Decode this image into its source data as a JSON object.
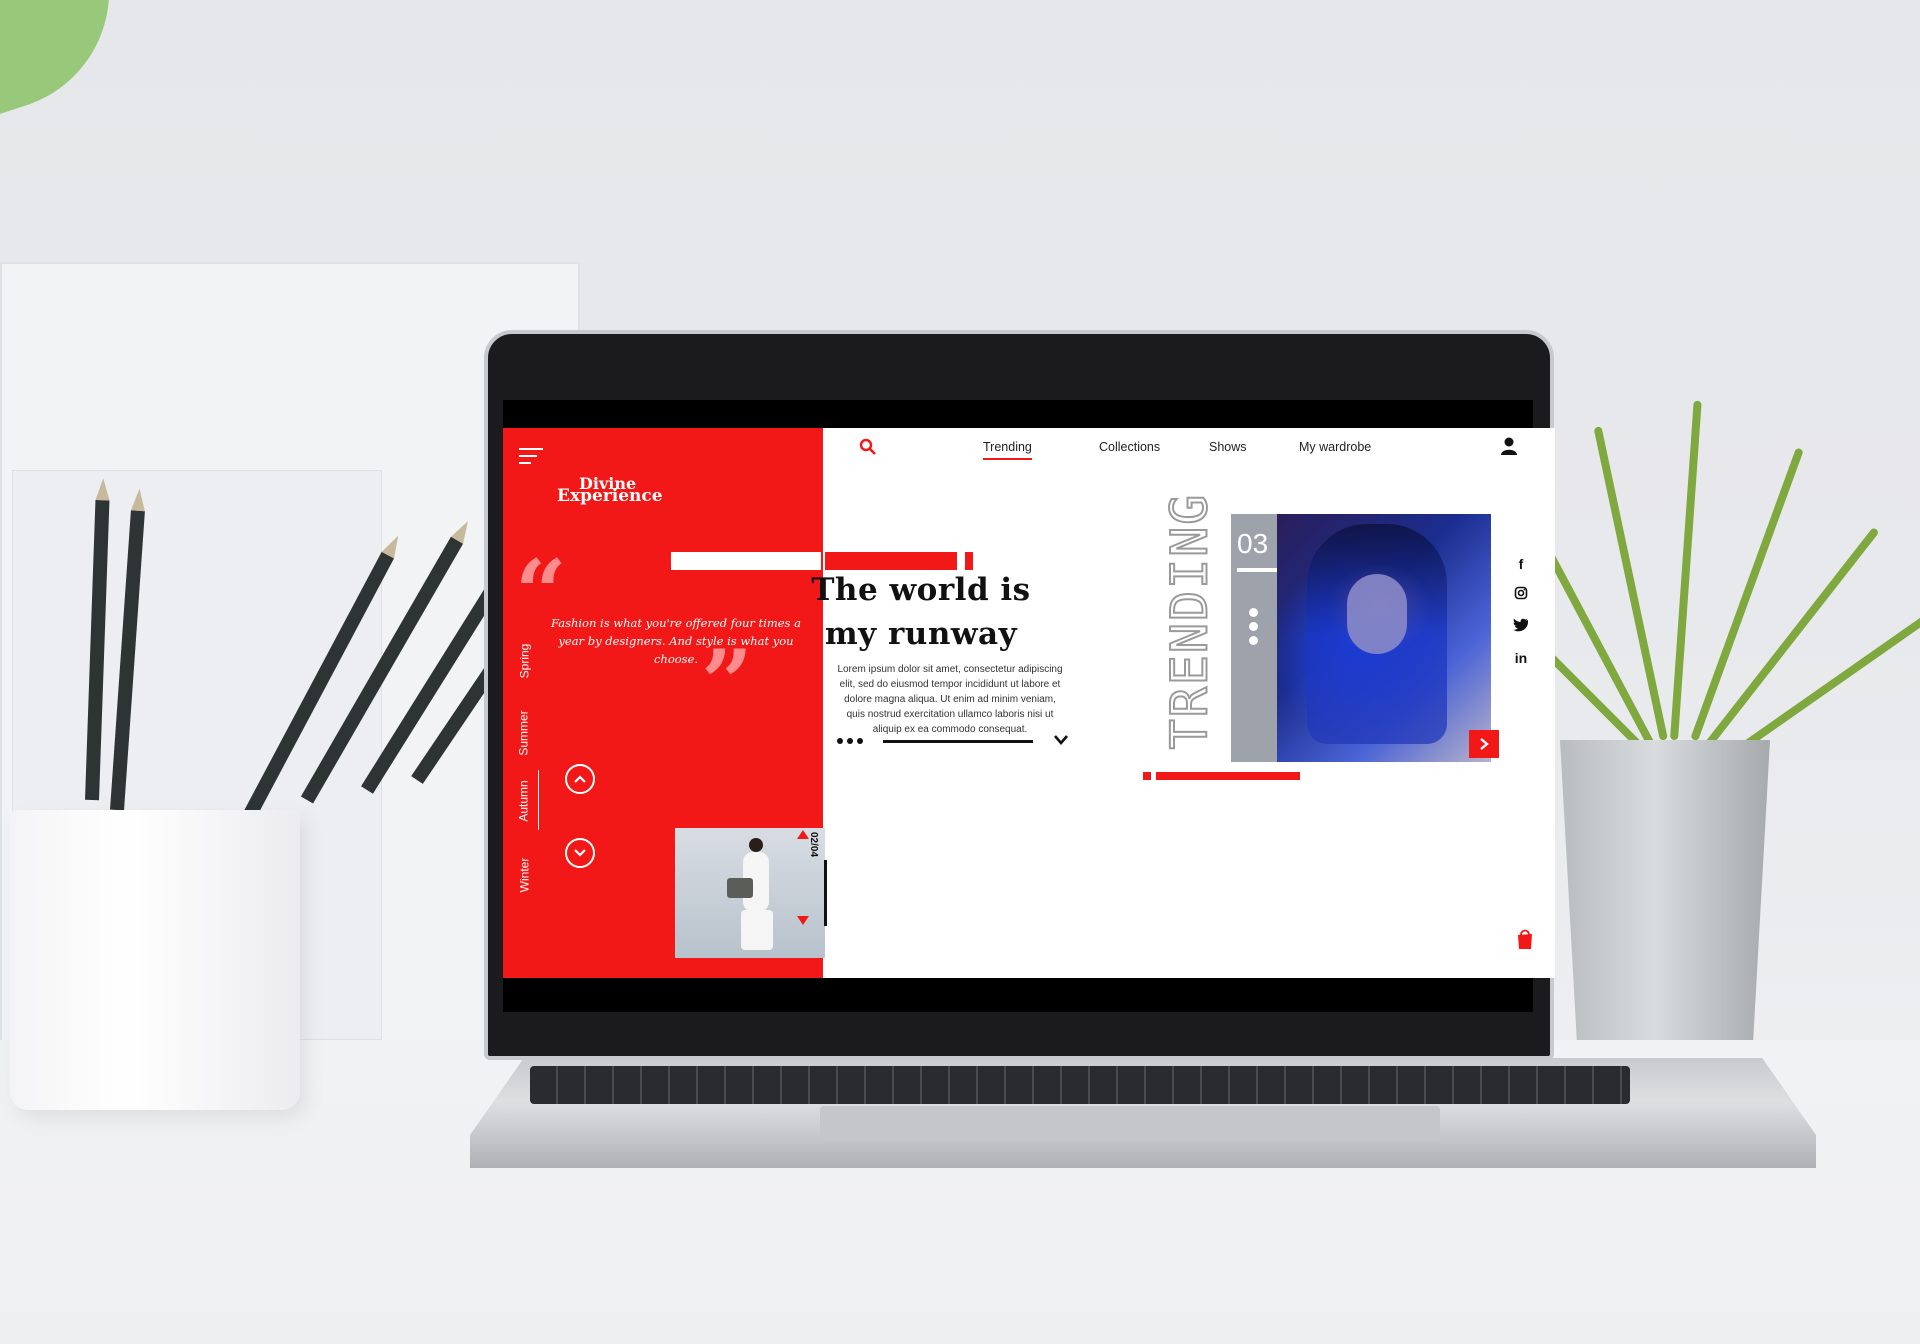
{
  "site": {
    "logo_line1": "Divine",
    "logo_line2": "Experience",
    "quote_open": "“",
    "quote_close": "”",
    "quote": "Fashion is what you're offered four times a year by designers. And style is what you choose.",
    "seasons": [
      "Spring",
      "Summer",
      "Autumn",
      "Winter"
    ],
    "active_season": "Autumn",
    "nav": {
      "links": [
        "Trending",
        "Collections",
        "Shows",
        "My wardrobe"
      ],
      "active": "Trending"
    },
    "hero": {
      "headline_line1": "The world is",
      "headline_line2": "my runway",
      "body": "Lorem ipsum dolor sit amet, consectetur adipiscing elit, sed do eiusmod tempor incididunt ut labore et dolore magna aliqua. Ut enim ad minim veniam, quis nostrud exercitation ullamco laboris nisi ut aliquip ex ea commodo consequat."
    },
    "pager": {
      "label": "02/04"
    },
    "trending": {
      "label": "TRENDING",
      "number": "03"
    },
    "social": [
      "f",
      "instagram",
      "twitter",
      "in"
    ],
    "social_labels": {
      "facebook": "f",
      "linkedin": "in"
    },
    "icons": {
      "menu": "hamburger-menu-icon",
      "search": "search-icon",
      "user": "user-icon",
      "up": "chevron-up-icon",
      "down": "chevron-down-icon",
      "next": "chevron-right-icon",
      "bag": "shopping-bag-icon"
    },
    "colors": {
      "accent": "#f21818",
      "text": "#111111",
      "quote_mark": "#ff8c8c"
    }
  }
}
